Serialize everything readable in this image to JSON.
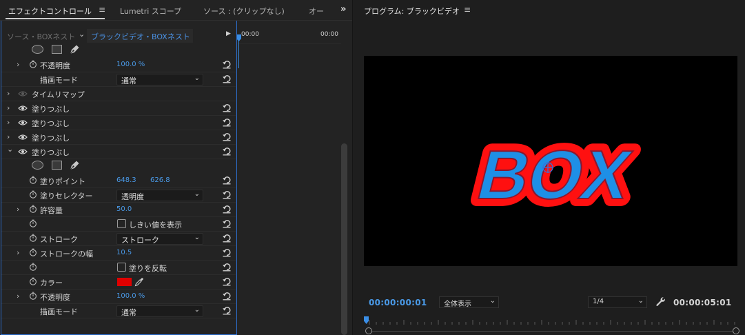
{
  "left_panel": {
    "tabs": [
      {
        "label": "エフェクトコントロール",
        "active": true
      },
      {
        "label": "Lumetri スコープ",
        "active": false
      },
      {
        "label": "ソース : (クリップなし)",
        "active": false
      },
      {
        "label": "オー",
        "active": false
      }
    ],
    "menu_glyph": "≡",
    "more_tabs_glyph": "»",
    "source_label": "ソース・BOXネスト",
    "sequence_label": "ブラックビデオ・BOXネスト",
    "timeline": {
      "time_start": "00:00",
      "time_end": "00:00"
    },
    "rows": [
      {
        "type": "shapes"
      },
      {
        "type": "param",
        "label": "不透明度",
        "value": "100.0 %",
        "twirl": true,
        "stopwatch": true,
        "reset": true
      },
      {
        "type": "dropdown",
        "label": "描画モード",
        "value": "通常",
        "reset": true
      },
      {
        "type": "effect",
        "label": "タイムリマップ",
        "eye_dim": true,
        "reset": false
      },
      {
        "type": "effect",
        "label": "塗りつぶし",
        "reset": true
      },
      {
        "type": "effect",
        "label": "塗りつぶし",
        "reset": true
      },
      {
        "type": "effect",
        "label": "塗りつぶし",
        "reset": true
      },
      {
        "type": "effect",
        "label": "塗りつぶし",
        "reset": true,
        "expanded": true
      },
      {
        "type": "shapes"
      },
      {
        "type": "point",
        "label": "塗りポイント",
        "x": "648.3",
        "y": "626.8",
        "reset": true
      },
      {
        "type": "dropdown",
        "label": "塗りセレクター",
        "value": "透明度",
        "stopwatch": true,
        "reset": true
      },
      {
        "type": "param",
        "label": "許容量",
        "value": "50.0",
        "twirl": true,
        "stopwatch": true,
        "reset": true
      },
      {
        "type": "checkbox",
        "label": "しきい値を表示",
        "stopwatch": true,
        "reset": true
      },
      {
        "type": "dropdown",
        "label": "ストローク",
        "value": "ストローク",
        "stopwatch": true,
        "reset": true
      },
      {
        "type": "param",
        "label": "ストロークの幅",
        "value": "10.5",
        "twirl": true,
        "stopwatch": true,
        "reset": true
      },
      {
        "type": "checkbox",
        "label": "塗りを反転",
        "stopwatch": true,
        "reset": true
      },
      {
        "type": "color",
        "label": "カラー",
        "color": "#e00000",
        "stopwatch": true,
        "reset": true
      },
      {
        "type": "param",
        "label": "不透明度",
        "value": "100.0 %",
        "twirl": true,
        "stopwatch": true,
        "reset": true
      },
      {
        "type": "dropdown",
        "label": "描画モード",
        "value": "通常",
        "reset": true
      }
    ]
  },
  "right_panel": {
    "title": "プログラム: ブラックビデオ",
    "menu_glyph": "≡",
    "frame_text": "BOX",
    "frame_text_fill": "#1e8fe6",
    "frame_text_stroke": "#ff1010",
    "timecode_current": "00:00:00:01",
    "zoom_value": "全体表示",
    "resolution_value": "1/4",
    "timecode_duration": "00:00:05:01"
  },
  "colors": {
    "accent_blue": "#4a9ae8",
    "panel_bg": "#232323",
    "focus_border": "#2d6fd0"
  }
}
